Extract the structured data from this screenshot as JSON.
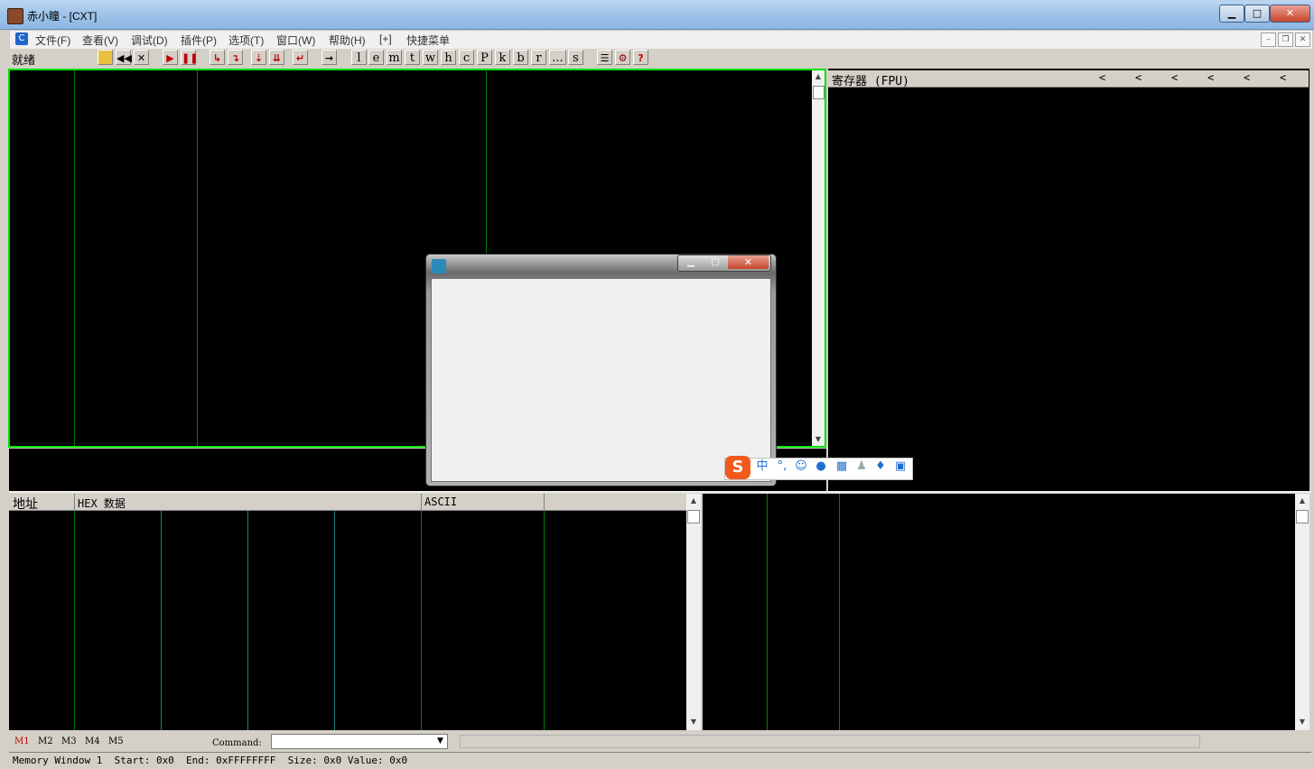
{
  "window": {
    "title": "赤小瞳 - [CXT]",
    "min_glyph": "▁",
    "max_glyph": "□",
    "close_glyph": "✕"
  },
  "menu": {
    "items": [
      "文件(F)",
      "查看(V)",
      "调试(D)",
      "插件(P)",
      "选项(T)",
      "窗口(W)",
      "帮助(H)",
      "[+]",
      "快捷菜单"
    ],
    "mdi_min": "–",
    "mdi_restore": "❐",
    "mdi_close": "✕"
  },
  "toolbar": {
    "status": "就绪",
    "letter_buttons": [
      "l",
      "e",
      "m",
      "t",
      "w",
      "h",
      "c",
      "P",
      "k",
      "b",
      "r",
      "...",
      "s"
    ],
    "help": "?"
  },
  "registers": {
    "header": "寄存器 (FPU)",
    "arrows": [
      "<",
      "<",
      "<",
      "<",
      "<",
      "<"
    ]
  },
  "dump": {
    "col_address": "地址",
    "col_hex": "HEX 数据",
    "col_ascii": "ASCII"
  },
  "bottom": {
    "tabs": [
      "M1",
      "M2",
      "M3",
      "M4",
      "M5"
    ],
    "command_label": "Command:",
    "status_text": "Memory Window 1  Start: 0x0  End: 0xFFFFFFFF  Size: 0x0 Value: 0x0"
  },
  "ime": {
    "logo": "S",
    "mode": "中",
    "punct": "°,",
    "icons": [
      "emoji-icon",
      "mic-icon",
      "keyboard-icon",
      "user-icon",
      "skin-icon",
      "toolbox-icon"
    ]
  },
  "colors": {
    "active_pane_border": "#00ff00",
    "pane_background": "#000000",
    "ime_accent": "#f05a1a"
  }
}
